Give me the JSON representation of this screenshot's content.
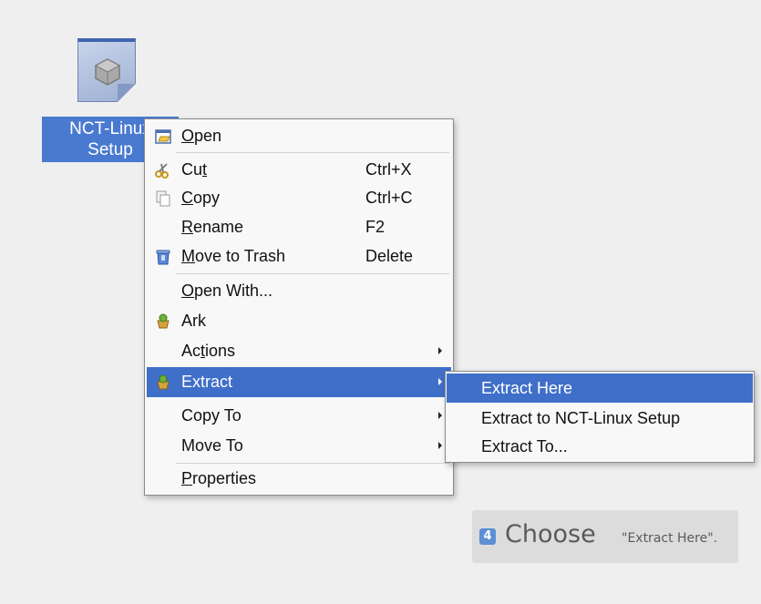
{
  "desktop": {
    "file": {
      "icon": "package-file-icon",
      "label_line1": "NCT-Linux",
      "label_line2": "Setup"
    }
  },
  "context_menu": {
    "items": [
      {
        "label_pre": "",
        "mnemonic": "O",
        "label_post": "pen",
        "shortcut": "",
        "icon": "open-icon"
      },
      {
        "label_pre": "Cu",
        "mnemonic": "t",
        "label_post": "",
        "shortcut": "Ctrl+X",
        "icon": "scissors-icon"
      },
      {
        "label_pre": "",
        "mnemonic": "C",
        "label_post": "opy",
        "shortcut": "Ctrl+C",
        "icon": "copy-icon"
      },
      {
        "label_pre": "",
        "mnemonic": "R",
        "label_post": "ename",
        "shortcut": "F2",
        "icon": ""
      },
      {
        "label_pre": "",
        "mnemonic": "M",
        "label_post": "ove to Trash",
        "shortcut": "Delete",
        "icon": "trash-icon"
      },
      {
        "label_pre": "",
        "mnemonic": "O",
        "label_post": "pen With...",
        "shortcut": "",
        "icon": ""
      },
      {
        "label_pre": "Ark",
        "mnemonic": "",
        "label_post": "",
        "shortcut": "",
        "icon": "ark-icon"
      },
      {
        "label_pre": "Ac",
        "mnemonic": "t",
        "label_post": "ions",
        "shortcut": "",
        "icon": "",
        "submenu": true
      },
      {
        "label_pre": "Extract",
        "mnemonic": "",
        "label_post": "",
        "shortcut": "",
        "icon": "ark-icon",
        "submenu": true,
        "highlighted": true
      },
      {
        "label_pre": "Copy To",
        "mnemonic": "",
        "label_post": "",
        "shortcut": "",
        "icon": "",
        "submenu": true
      },
      {
        "label_pre": "Move To",
        "mnemonic": "",
        "label_post": "",
        "shortcut": "",
        "icon": "",
        "submenu": true
      },
      {
        "label_pre": "",
        "mnemonic": "P",
        "label_post": "roperties",
        "shortcut": "",
        "icon": ""
      }
    ]
  },
  "extract_submenu": {
    "items": [
      {
        "label": "Extract Here",
        "highlighted": true
      },
      {
        "label": "Extract to NCT-Linux Setup"
      },
      {
        "label": "Extract To..."
      }
    ]
  },
  "callout": {
    "step": "4",
    "word": "Choose",
    "target": "\"Extract Here\"."
  },
  "colors": {
    "highlight": "#3f6fc8",
    "background": "#efefef",
    "menu_bg": "#f8f8f8"
  }
}
